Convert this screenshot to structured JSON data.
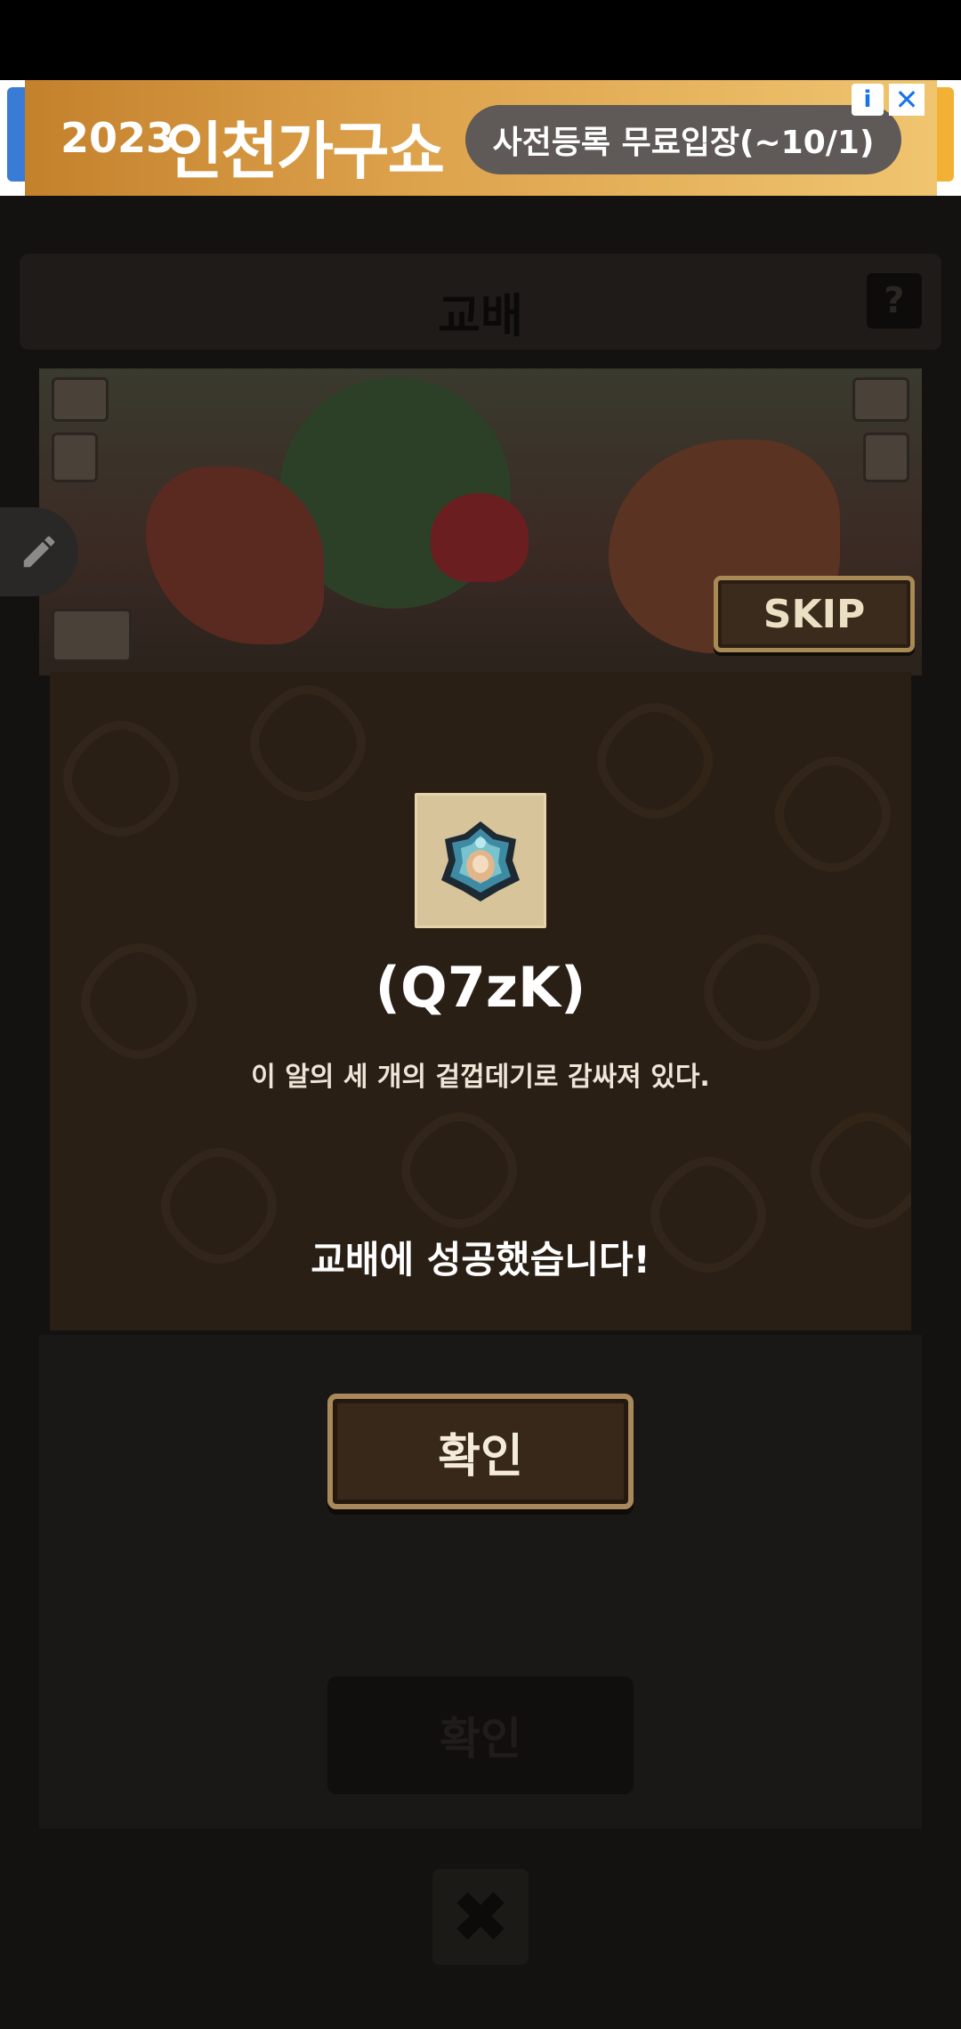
{
  "ad": {
    "year": "2023",
    "title": "인천가구쇼",
    "cta": "사전등록 무료입장(~10/1)",
    "info_icon": "info-icon",
    "close_icon": "close-icon"
  },
  "header": {
    "title": "교배",
    "help_label": "?"
  },
  "scene": {
    "skip_label": "SKIP"
  },
  "result": {
    "item_name": "(Q7zK)",
    "item_description": "이 알의 세 개의 겉껍데기로 감싸져 있다.",
    "message": "교배에 성공했습니다!",
    "confirm_label": "확인"
  },
  "background": {
    "confirm_label": "확인",
    "close_label": "✖"
  },
  "colors": {
    "dialog_bg": "#2a1f15",
    "button_border": "#a9895a",
    "ad_gradient_start": "#c4812c",
    "ad_gradient_end": "#f0c570"
  }
}
